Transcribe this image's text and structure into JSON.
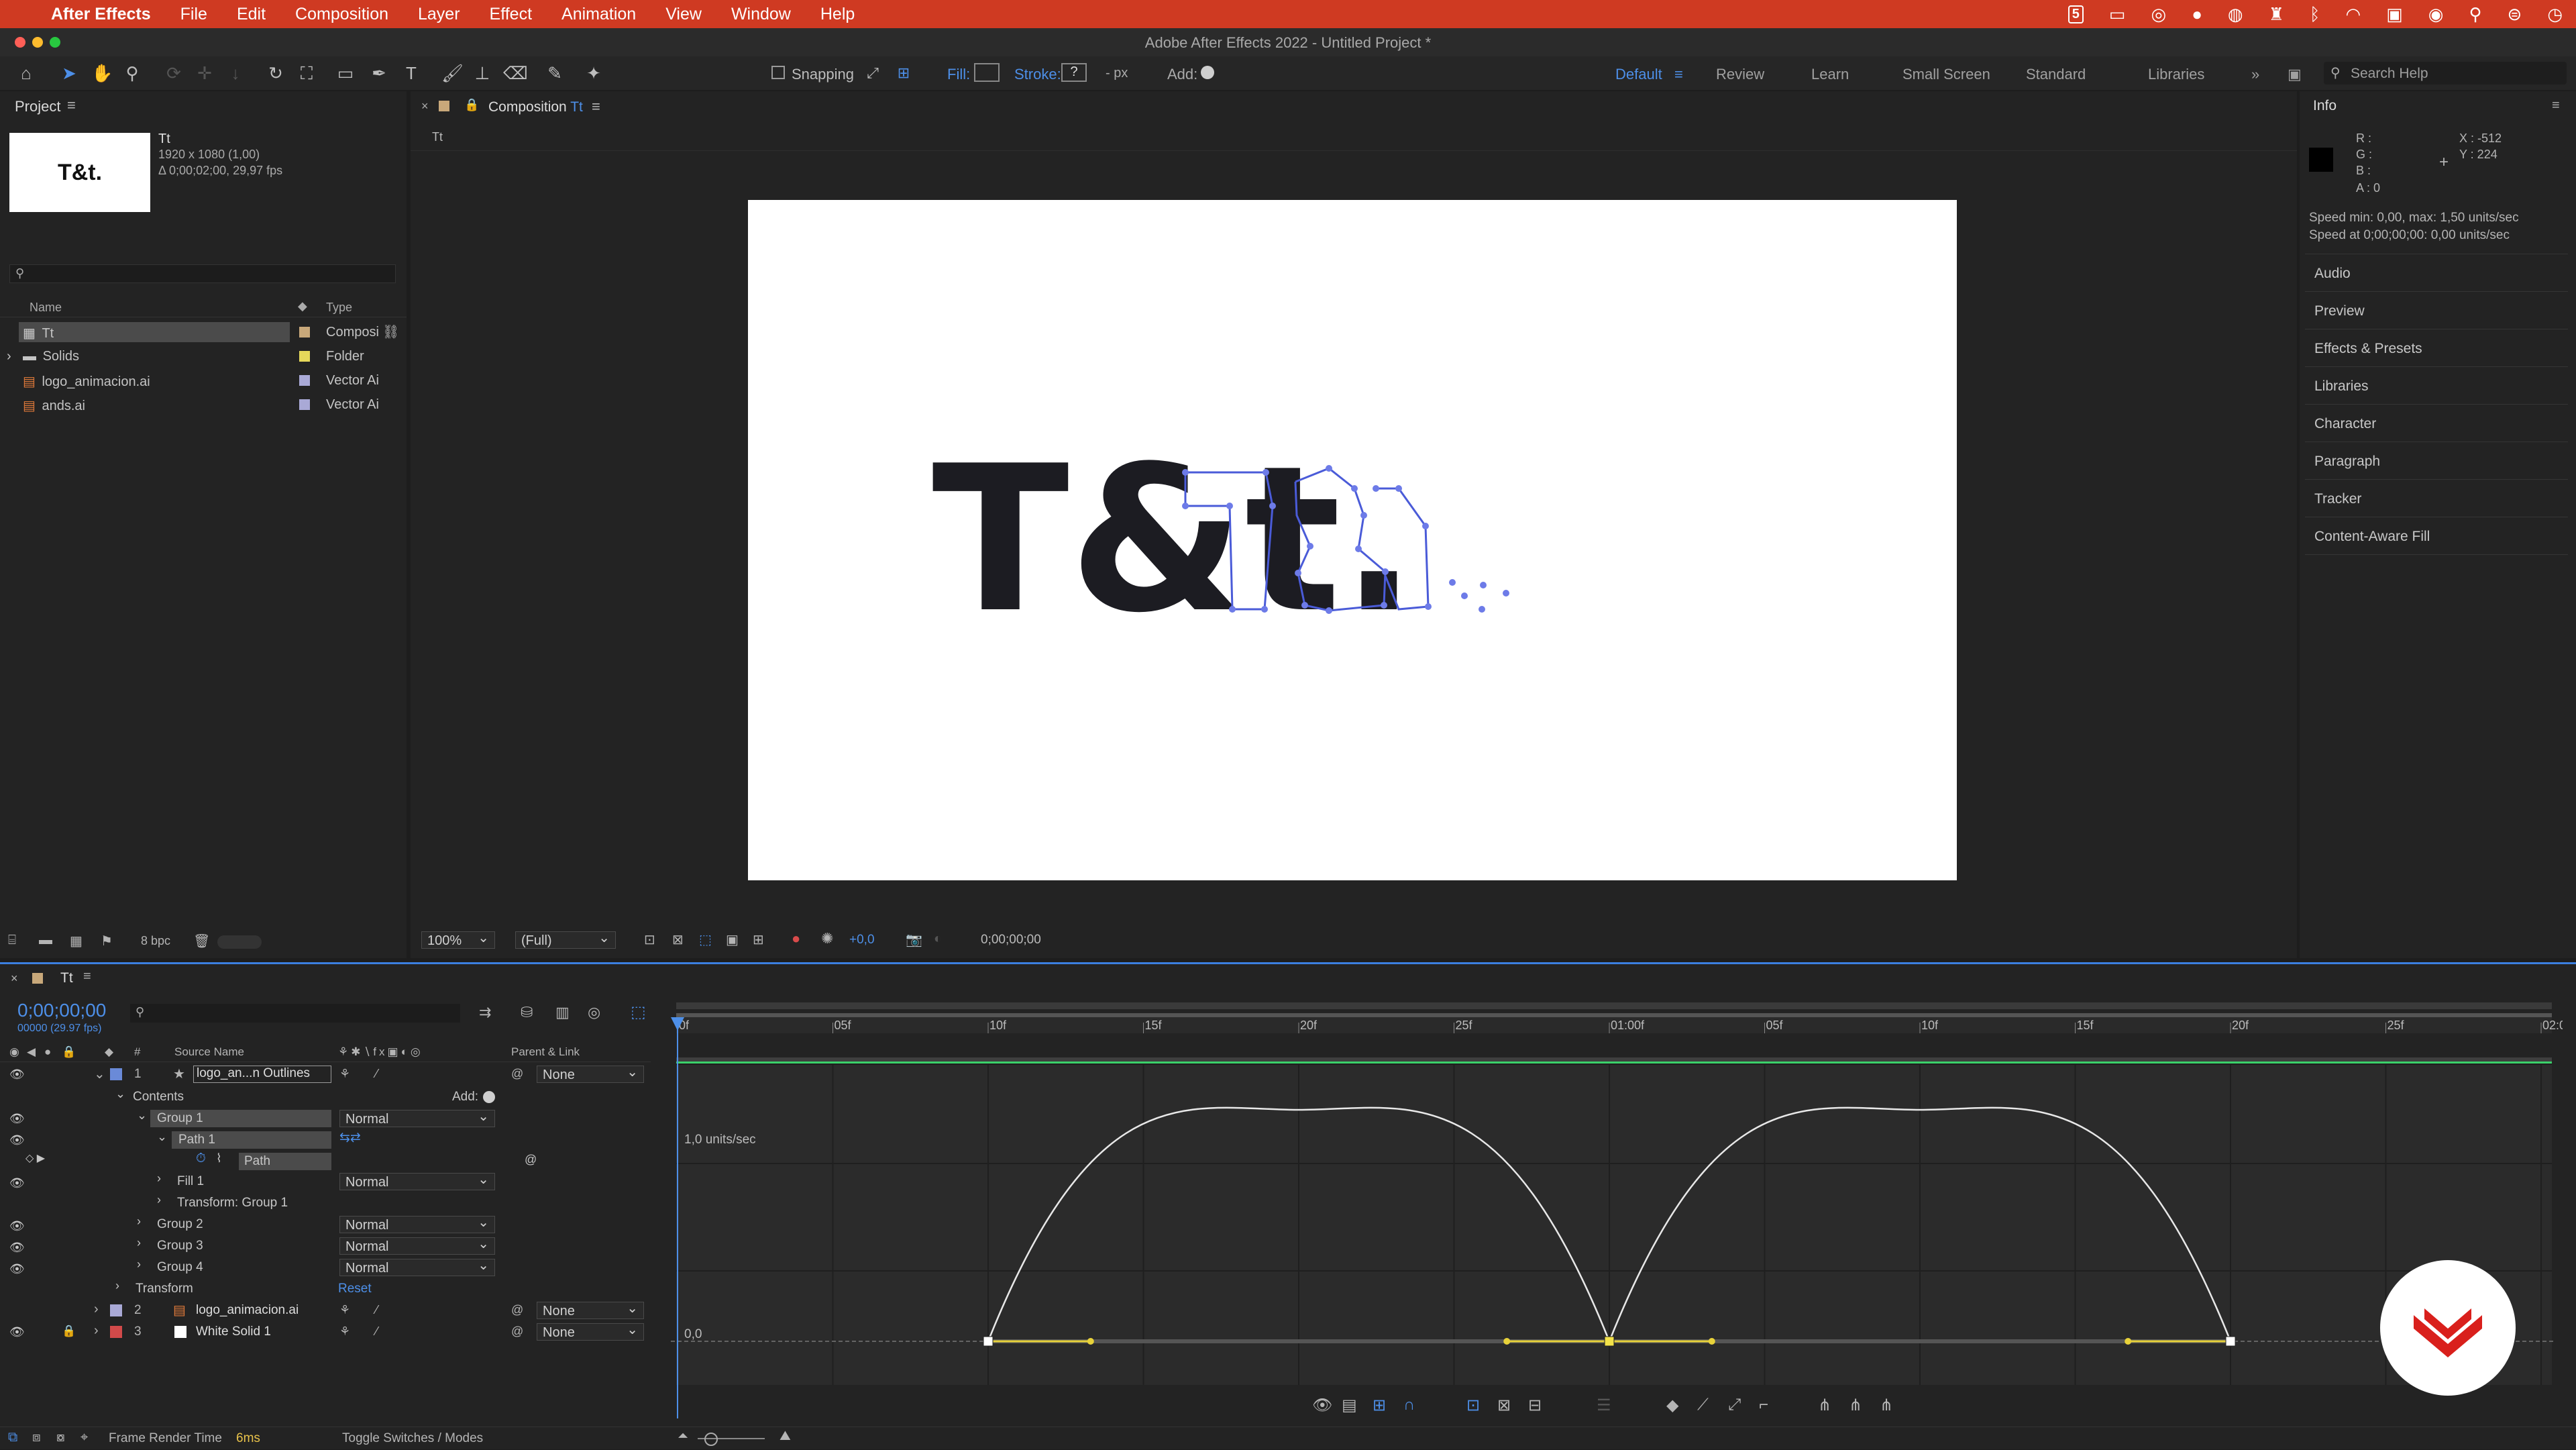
{
  "menubar": {
    "app_name": "After Effects",
    "items": [
      "File",
      "Edit",
      "Composition",
      "Layer",
      "Effect",
      "Animation",
      "View",
      "Window",
      "Help"
    ],
    "right_icons": [
      "five-icon",
      "screen-icon",
      "creative-cloud-icon",
      "sync-icon",
      "drive-icon",
      "castle-icon",
      "bluetooth-icon",
      "wifi-icon",
      "battery-icon",
      "user-icon",
      "spotlight-icon",
      "control-center-icon",
      "clock-icon"
    ]
  },
  "window": {
    "title": "Adobe After Effects 2022 - Untitled Project *",
    "colors": {
      "close": "#ff5f57",
      "minimize": "#febc2e",
      "zoom": "#28c840"
    }
  },
  "toolbar": {
    "snapping_label": "Snapping",
    "fill_label": "Fill:",
    "stroke_label": "Stroke:",
    "stroke_value": "?",
    "stroke_unit": "- px",
    "add_label": "Add:",
    "workspaces": [
      "Default",
      "Review",
      "Learn",
      "Small Screen",
      "Standard",
      "Libraries"
    ],
    "active_workspace": "Default",
    "search_placeholder": "Search Help"
  },
  "project": {
    "title": "Project",
    "thumb_text": "T&t.",
    "comp_name": "Tt",
    "comp_dims": "1920 x 1080 (1,00)",
    "comp_dur": "Δ 0;00;02;00, 29,97 fps",
    "search_placeholder": "",
    "col_name": "Name",
    "col_type": "Type",
    "items": [
      {
        "name": "Tt",
        "type": "Composi",
        "color": "#c8a87a",
        "icon": "composition-icon"
      },
      {
        "name": "Solids",
        "type": "Folder",
        "color": "#e6d85a",
        "icon": "folder-icon"
      },
      {
        "name": "logo_animacion.ai",
        "type": "Vector Ai",
        "color": "#a9a9d6",
        "icon": "illustrator-file-icon"
      },
      {
        "name": "ands.ai",
        "type": "Vector Ai",
        "color": "#a9a9d6",
        "icon": "illustrator-file-icon"
      }
    ],
    "bpc": "8 bpc"
  },
  "composition": {
    "tab_label": "Composition",
    "tab_name": "Tt",
    "breadcrumb": "Tt",
    "canvas_text": "T&t.",
    "zoom": "100%",
    "resolution": "(Full)",
    "exposure": "+0,0",
    "timecode": "0;00;00;00"
  },
  "info": {
    "title": "Info",
    "r": "R :",
    "g": "G :",
    "b": "B :",
    "a": "A :  0",
    "x": "X : -512",
    "y": "Y : 224",
    "speed1": "Speed min: 0,00, max: 1,50 units/sec",
    "speed2": "Speed at 0;00;00;00: 0,00 units/sec",
    "panels": [
      "Audio",
      "Preview",
      "Effects & Presets",
      "Libraries",
      "Character",
      "Paragraph",
      "Tracker",
      "Content-Aware Fill"
    ]
  },
  "timeline": {
    "tab_name": "Tt",
    "timecode": "0;00;00;00",
    "fps": "00000 (29.97 fps)",
    "col_source": "Source Name",
    "col_parent": "Parent & Link",
    "ruler": [
      "0f",
      "05f",
      "10f",
      "15f",
      "20f",
      "25f",
      "01:00f",
      "05f",
      "10f",
      "15f",
      "20f",
      "25f",
      "02:0"
    ],
    "graph_label_top": "1,0 units/sec",
    "graph_label_zero": "0,0",
    "layers": [
      {
        "num": "1",
        "name": "logo_an...n Outlines",
        "parent": "None"
      },
      {
        "num": "2",
        "name": "logo_animacion.ai",
        "parent": "None"
      },
      {
        "num": "3",
        "name": "White Solid 1",
        "parent": "None"
      }
    ],
    "props": {
      "contents": "Contents",
      "add": "Add:",
      "group1": "Group 1",
      "path1": "Path 1",
      "path": "Path",
      "fill1": "Fill 1",
      "transform_group1": "Transform: Group 1",
      "group2": "Group 2",
      "group3": "Group 3",
      "group4": "Group 4",
      "transform": "Transform",
      "reset": "Reset",
      "blend": "Normal"
    },
    "footer_render": "Frame Render Time",
    "footer_render_ms": "6ms",
    "footer_toggle": "Toggle Switches / Modes"
  },
  "chart_data": {
    "type": "line",
    "title": "",
    "xlabel": "",
    "ylabel": "",
    "x_unit": "frames",
    "x": [
      10,
      20,
      30,
      40,
      50
    ],
    "series": [
      {
        "values": [
          0,
          1.5,
          0,
          1.5,
          0
        ]
      }
    ],
    "keyframes_x": [
      10,
      30,
      50
    ],
    "ylim": [
      0,
      1.5
    ]
  }
}
